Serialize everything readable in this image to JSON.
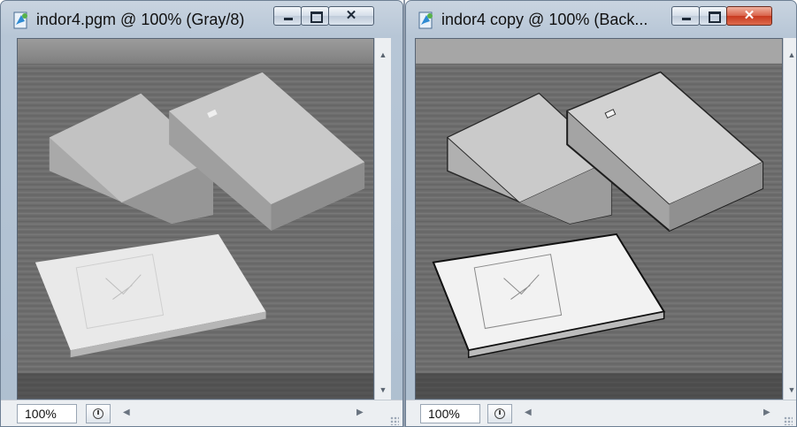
{
  "windows": [
    {
      "title": "indor4.pgm @ 100% (Gray/8)",
      "zoom": "100%",
      "image": "grayscale photo of three books on a wooden desk"
    },
    {
      "title": "indor4 copy @ 100% (Back...",
      "zoom": "100%",
      "image": "edge-enhanced copy of the same photo"
    }
  ],
  "icons": {
    "app": "photoshop-document-icon",
    "minimize": "minimize-icon",
    "maximize": "maximize-icon",
    "close": "close-icon",
    "scroll_up": "scroll-up-arrow-icon",
    "scroll_down": "scroll-down-arrow-icon",
    "scroll_left": "scroll-left-arrow-icon",
    "scroll_right": "scroll-right-arrow-icon",
    "document_status": "document-status-icon"
  },
  "colors": {
    "titlebar": "#b7c6d6",
    "close_active": "#c8391f",
    "desk_wood": "#6e6e6e",
    "book_surface": "#bcbcbc"
  }
}
